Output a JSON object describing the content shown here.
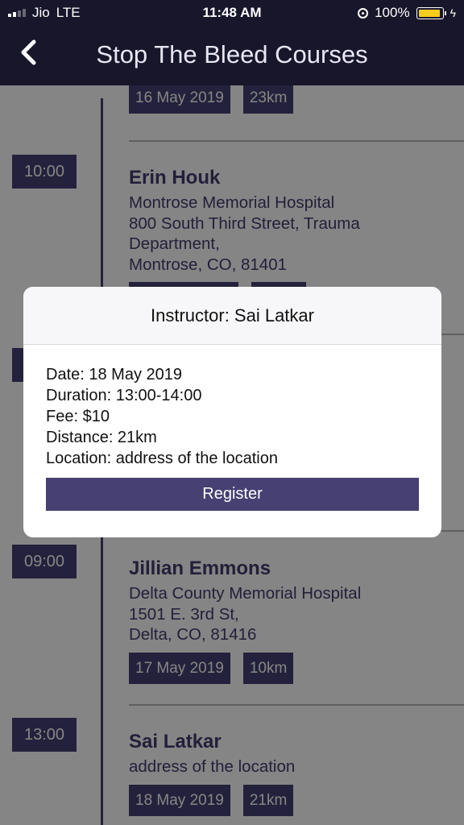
{
  "status_bar": {
    "carrier": "Jio",
    "network": "LTE",
    "time": "11:48 AM",
    "battery": "100%"
  },
  "nav": {
    "title": "Stop The Bleed Courses"
  },
  "courses": [
    {
      "time": "",
      "name": "",
      "address": "",
      "date": "16 May 2019",
      "distance": "23km"
    },
    {
      "time": "10:00",
      "name": "Erin Houk",
      "address_lines": [
        "Montrose Memorial Hospital",
        "800 South Third Street, Trauma",
        "Department,",
        "Montrose, CO, 81401"
      ],
      "date": "",
      "distance": ""
    },
    {
      "time": "09:00",
      "name": "Jillian Emmons",
      "address_lines": [
        "Delta County Memorial Hospital",
        "1501 E. 3rd St,",
        "Delta, CO, 81416"
      ],
      "date": "17 May 2019",
      "distance": "10km"
    },
    {
      "time": "13:00",
      "name": "Sai Latkar",
      "address_lines": [
        "address of the location"
      ],
      "date": "18 May 2019",
      "distance": "21km"
    }
  ],
  "dialog": {
    "title": "Instructor: Sai Latkar",
    "date": "Date: 18 May 2019",
    "duration": "Duration: 13:00-14:00",
    "fee": "Fee: $10",
    "distance": "Distance: 21km",
    "location": "Location: address of the location",
    "register_label": "Register"
  },
  "colors": {
    "accent": "#464073",
    "nav_bg": "#18162b",
    "battery": "#f6cc1d"
  }
}
